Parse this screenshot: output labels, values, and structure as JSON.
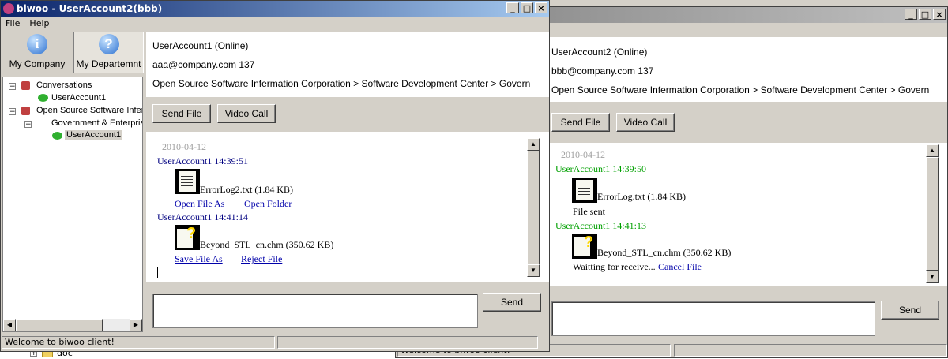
{
  "back_window": {
    "info": {
      "user_status": "UserAccount2 (Online)",
      "email_line": "bbb@company.com   137",
      "org_path": "Open Source Software Infermation Corporation > Software Development Center > Govern"
    },
    "buttons": {
      "send_file": "Send File",
      "video_call": "Video Call",
      "send": "Send"
    },
    "chat": {
      "date": "2010-04-12",
      "msg1_header": "UserAccount1 14:39:50",
      "msg1_file": "ErrorLog.txt (1.84 KB)",
      "msg1_status": "File sent",
      "msg2_header": "UserAccount1 14:41:13",
      "msg2_file": "Beyond_STL_cn.chm (350.62 KB)",
      "msg2_status": "Waitting for receive...",
      "msg2_cancel": "Cancel File"
    },
    "status_text": "Welcome to biwoo client!"
  },
  "front_window": {
    "title": "biwoo - UserAccount2(bbb)",
    "menu": {
      "file": "File",
      "help": "Help"
    },
    "toolbar": {
      "my_company": "My Company",
      "my_department": "My Departemnt"
    },
    "tree": {
      "conversations": "Conversations",
      "conv_user": "UserAccount1",
      "org": "Open Source Software Infer",
      "dept": "Government & Enterpris",
      "dept_user": "UserAccount1"
    },
    "info": {
      "user_status": "UserAccount1 (Online)",
      "email_line": "aaa@company.com   137",
      "org_path": "Open Source Software Infermation Corporation > Software Development Center > Govern"
    },
    "buttons": {
      "send_file": "Send File",
      "video_call": "Video Call",
      "send": "Send"
    },
    "chat": {
      "date": "2010-04-12",
      "msg1_header": "UserAccount1 14:39:51",
      "msg1_file": "ErrorLog2.txt (1.84 KB)",
      "msg1_open_as": "Open File As",
      "msg1_open_folder": "Open Folder",
      "msg2_header": "UserAccount1 14:41:14",
      "msg2_file": "Beyond_STL_cn.chm (350.62 KB)",
      "msg2_save_as": "Save File As",
      "msg2_reject": "Reject File"
    },
    "status_text": "Welcome to biwoo client!"
  },
  "background": {
    "folder_label": "doc",
    "status_fragment": "Welcome to biwoo client!"
  }
}
